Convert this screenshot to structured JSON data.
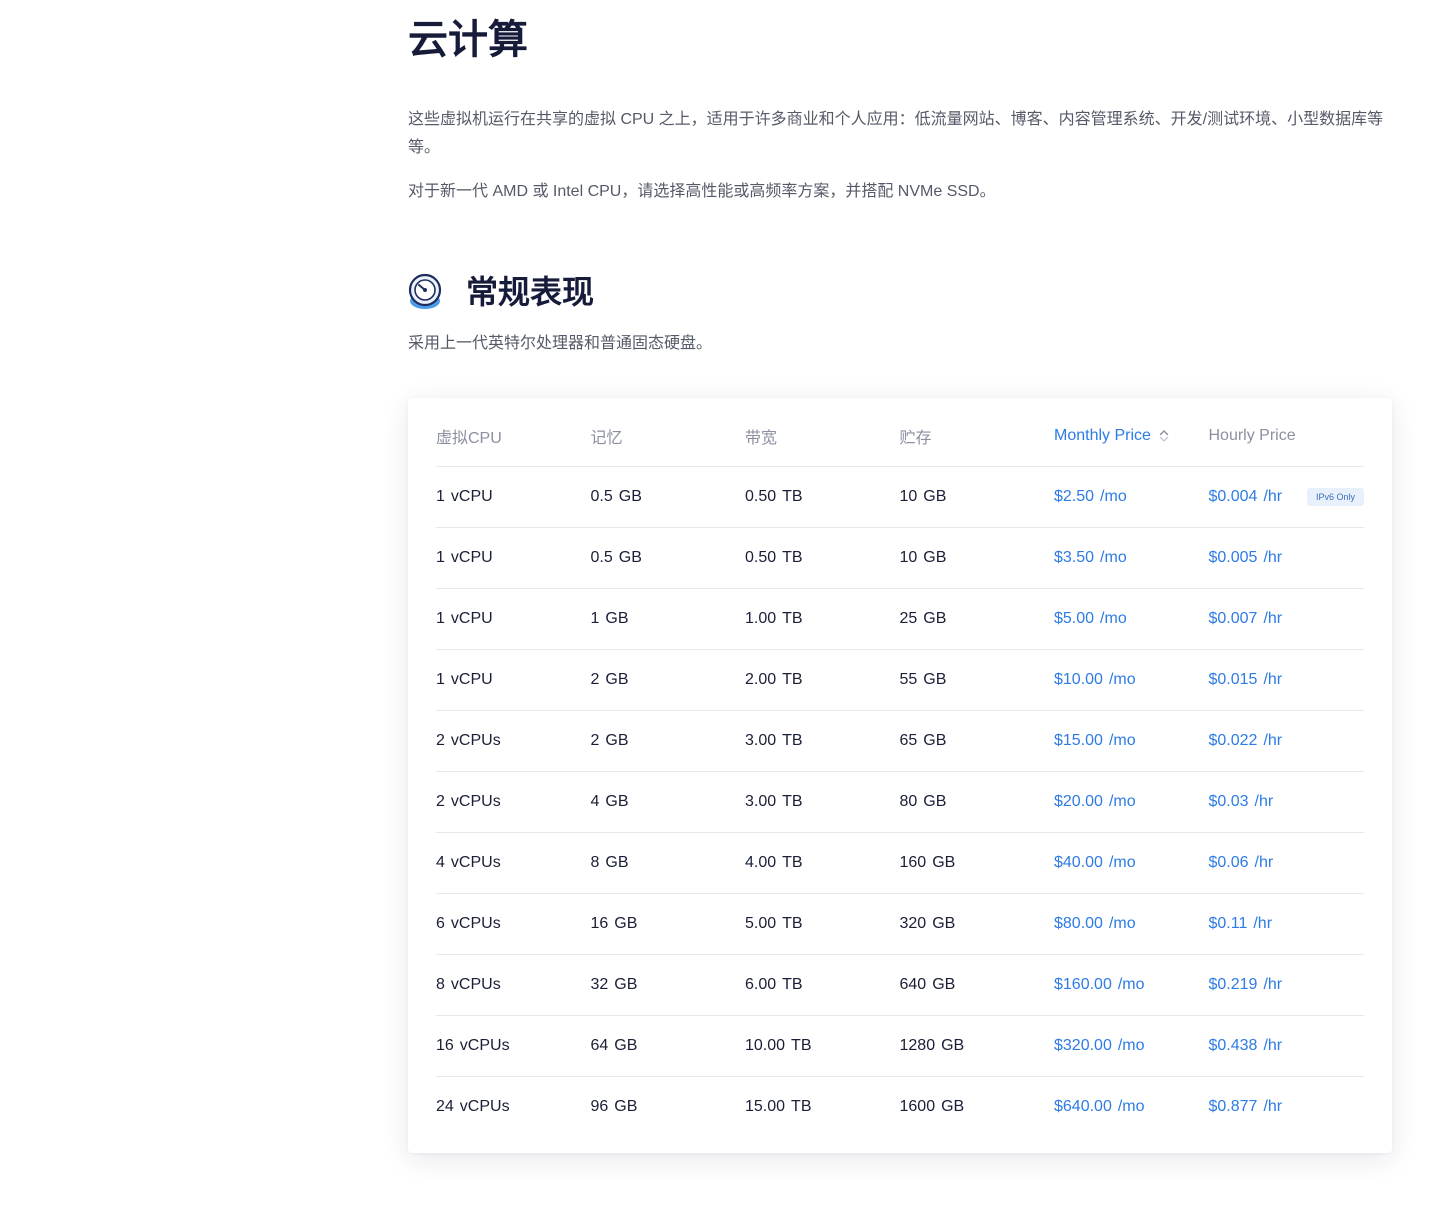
{
  "page": {
    "title": "云计算",
    "intro": "这些虚拟机运行在共享的虚拟 CPU 之上，适用于许多商业和个人应用：低流量网站、博客、内容管理系统、开发/测试环境、小型数据库等等。",
    "intro2": "对于新一代 AMD 或 Intel CPU，请选择高性能或高频率方案，并搭配 NVMe SSD。"
  },
  "section": {
    "icon": "speedometer-icon",
    "title": "常规表现",
    "description": "采用上一代英特尔处理器和普通固态硬盘。"
  },
  "table": {
    "headers": {
      "vcpu": "虚拟CPU",
      "memory": "记忆",
      "bandwidth": "带宽",
      "storage": "贮存",
      "monthly": "Monthly Price",
      "hourly": "Hourly Price"
    },
    "sort": {
      "column": "monthly",
      "icon": "sort-icon"
    },
    "rows": [
      {
        "vcpu": "1",
        "vcpu_unit": "vCPU",
        "mem": "0.5",
        "mem_unit": "GB",
        "bw": "0.50",
        "bw_unit": "TB",
        "disk": "10",
        "disk_unit": "GB",
        "monthly": "$2.50",
        "monthly_unit": "/mo",
        "hourly": "$0.004",
        "hourly_unit": "/hr",
        "badge": "IPv6 Only"
      },
      {
        "vcpu": "1",
        "vcpu_unit": "vCPU",
        "mem": "0.5",
        "mem_unit": "GB",
        "bw": "0.50",
        "bw_unit": "TB",
        "disk": "10",
        "disk_unit": "GB",
        "monthly": "$3.50",
        "monthly_unit": "/mo",
        "hourly": "$0.005",
        "hourly_unit": "/hr",
        "badge": ""
      },
      {
        "vcpu": "1",
        "vcpu_unit": "vCPU",
        "mem": "1",
        "mem_unit": "GB",
        "bw": "1.00",
        "bw_unit": "TB",
        "disk": "25",
        "disk_unit": "GB",
        "monthly": "$5.00",
        "monthly_unit": "/mo",
        "hourly": "$0.007",
        "hourly_unit": "/hr",
        "badge": ""
      },
      {
        "vcpu": "1",
        "vcpu_unit": "vCPU",
        "mem": "2",
        "mem_unit": "GB",
        "bw": "2.00",
        "bw_unit": "TB",
        "disk": "55",
        "disk_unit": "GB",
        "monthly": "$10.00",
        "monthly_unit": "/mo",
        "hourly": "$0.015",
        "hourly_unit": "/hr",
        "badge": ""
      },
      {
        "vcpu": "2",
        "vcpu_unit": "vCPUs",
        "mem": "2",
        "mem_unit": "GB",
        "bw": "3.00",
        "bw_unit": "TB",
        "disk": "65",
        "disk_unit": "GB",
        "monthly": "$15.00",
        "monthly_unit": "/mo",
        "hourly": "$0.022",
        "hourly_unit": "/hr",
        "badge": ""
      },
      {
        "vcpu": "2",
        "vcpu_unit": "vCPUs",
        "mem": "4",
        "mem_unit": "GB",
        "bw": "3.00",
        "bw_unit": "TB",
        "disk": "80",
        "disk_unit": "GB",
        "monthly": "$20.00",
        "monthly_unit": "/mo",
        "hourly": "$0.03",
        "hourly_unit": "/hr",
        "badge": ""
      },
      {
        "vcpu": "4",
        "vcpu_unit": "vCPUs",
        "mem": "8",
        "mem_unit": "GB",
        "bw": "4.00",
        "bw_unit": "TB",
        "disk": "160",
        "disk_unit": "GB",
        "monthly": "$40.00",
        "monthly_unit": "/mo",
        "hourly": "$0.06",
        "hourly_unit": "/hr",
        "badge": ""
      },
      {
        "vcpu": "6",
        "vcpu_unit": "vCPUs",
        "mem": "16",
        "mem_unit": "GB",
        "bw": "5.00",
        "bw_unit": "TB",
        "disk": "320",
        "disk_unit": "GB",
        "monthly": "$80.00",
        "monthly_unit": "/mo",
        "hourly": "$0.11",
        "hourly_unit": "/hr",
        "badge": ""
      },
      {
        "vcpu": "8",
        "vcpu_unit": "vCPUs",
        "mem": "32",
        "mem_unit": "GB",
        "bw": "6.00",
        "bw_unit": "TB",
        "disk": "640",
        "disk_unit": "GB",
        "monthly": "$160.00",
        "monthly_unit": "/mo",
        "hourly": "$0.219",
        "hourly_unit": "/hr",
        "badge": ""
      },
      {
        "vcpu": "16",
        "vcpu_unit": "vCPUs",
        "mem": "64",
        "mem_unit": "GB",
        "bw": "10.00",
        "bw_unit": "TB",
        "disk": "1280",
        "disk_unit": "GB",
        "monthly": "$320.00",
        "monthly_unit": "/mo",
        "hourly": "$0.438",
        "hourly_unit": "/hr",
        "badge": ""
      },
      {
        "vcpu": "24",
        "vcpu_unit": "vCPUs",
        "mem": "96",
        "mem_unit": "GB",
        "bw": "15.00",
        "bw_unit": "TB",
        "disk": "1600",
        "disk_unit": "GB",
        "monthly": "$640.00",
        "monthly_unit": "/mo",
        "hourly": "$0.877",
        "hourly_unit": "/hr",
        "badge": ""
      }
    ]
  },
  "colors": {
    "accent": "#2d7be5",
    "heading": "#161b39",
    "body_text": "#555a68",
    "muted": "#8b90a0",
    "divider": "#e6e8ee",
    "badge_bg": "#e8f0fc"
  }
}
